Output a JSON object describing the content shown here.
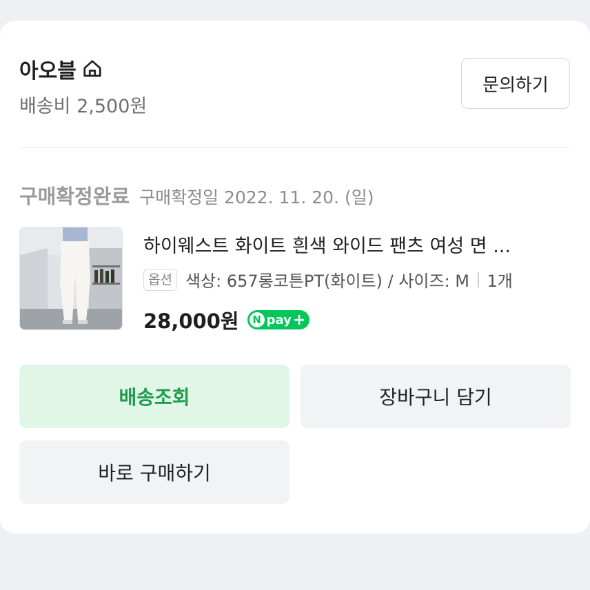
{
  "store": {
    "name": "아오블",
    "shipping_fee": "배송비 2,500원",
    "inquiry_label": "문의하기"
  },
  "order": {
    "status": "구매확정완료",
    "confirm_date": "구매확정일 2022. 11. 20. (일)"
  },
  "product": {
    "title": "하이웨스트 화이트 흰색 와이드 팬츠 여성 면 ...",
    "option_badge": "옵션",
    "option_text": "색상: 657롱코튼PT(화이트) / 사이즈: M",
    "quantity": "1개",
    "price": "28,000원",
    "pay_badge": {
      "n": "N",
      "text": "pay",
      "plus": "+"
    }
  },
  "actions": {
    "track_label": "배송조회",
    "cart_label": "장바구니 담기",
    "buy_label": "바로 구매하기"
  },
  "colors": {
    "accent_green": "#1f9b4c",
    "track_bg": "#e0f6e6",
    "npay_green": "#03c75a"
  }
}
